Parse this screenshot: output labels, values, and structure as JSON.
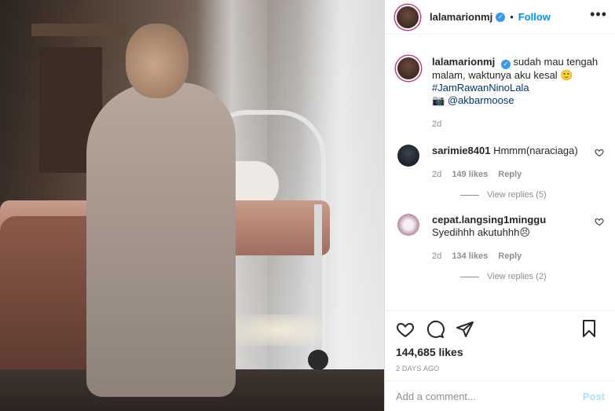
{
  "post": {
    "username": "lalamarionmj",
    "follow_label": "Follow",
    "more_label": "•••",
    "separator": "•"
  },
  "caption": {
    "username": "lalamarionmj",
    "text_main": "sudah mau tengah malam, waktunya aku kesal 🙂",
    "hashtag": "#JamRawanNinoLala",
    "camera_emoji": "📷",
    "mention": "@akbarmoose",
    "time": "2d"
  },
  "comments": [
    {
      "username": "sarimie8401",
      "text": "Hmmm(naraciaga)",
      "time": "2d",
      "likes": "149 likes",
      "reply_label": "Reply",
      "view_replies": "View replies (5)"
    },
    {
      "username": "cepat.langsing1minggu",
      "text": "Syedihhh akutuhhh😣",
      "time": "2d",
      "likes": "134 likes",
      "reply_label": "Reply",
      "view_replies": "View replies (2)"
    }
  ],
  "actions": {
    "likes": "144,685 likes",
    "time_ago": "2 DAYS AGO"
  },
  "add_comment": {
    "placeholder": "Add a comment...",
    "post_label": "Post"
  },
  "colors": {
    "accent": "#0095f6",
    "verified": "#3897f0",
    "link_dark": "#00376b",
    "muted": "#8e8e8e",
    "post_disabled": "#b2dffc"
  },
  "icons": [
    "verified-badge-icon",
    "more-options-icon",
    "heart-icon",
    "comment-icon",
    "share-icon",
    "bookmark-icon",
    "camera-icon"
  ]
}
